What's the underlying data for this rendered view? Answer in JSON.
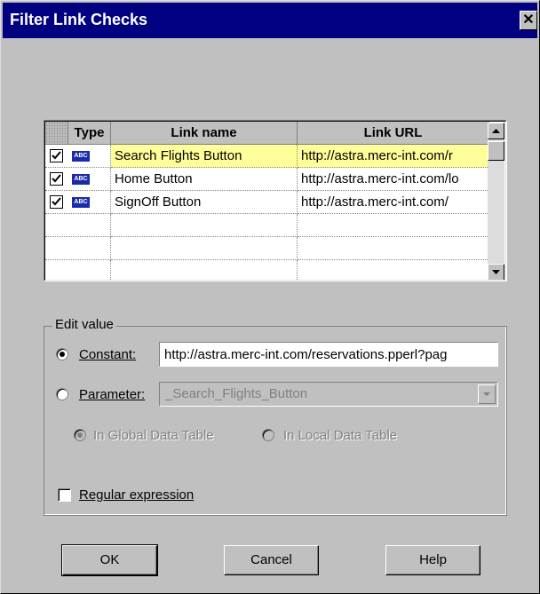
{
  "window": {
    "title": "Filter Link Checks",
    "close_glyph": "✕"
  },
  "grid": {
    "headers": {
      "type": "Type",
      "link_name": "Link name",
      "link_url": "Link URL"
    },
    "type_badge": "ABC",
    "rows": [
      {
        "checked": true,
        "name": "Search Flights Button",
        "url": "http://astra.merc-int.com/r",
        "selected": true
      },
      {
        "checked": true,
        "name": "Home Button",
        "url": "http://astra.merc-int.com/lo",
        "selected": false
      },
      {
        "checked": true,
        "name": "SignOff Button",
        "url": "http://astra.merc-int.com/",
        "selected": false
      }
    ]
  },
  "edit_value": {
    "group_label": "Edit value",
    "constant_label": "Constant:",
    "constant_value": "http://astra.merc-int.com/reservations.pperl?pag",
    "parameter_label": "Parameter:",
    "parameter_value": "_Search_Flights_Button",
    "global_table_label": "In Global Data Table",
    "local_table_label": "In Local Data Table",
    "regex_label": "Regular expression"
  },
  "buttons": {
    "ok": "OK",
    "cancel": "Cancel",
    "help": "Help"
  }
}
